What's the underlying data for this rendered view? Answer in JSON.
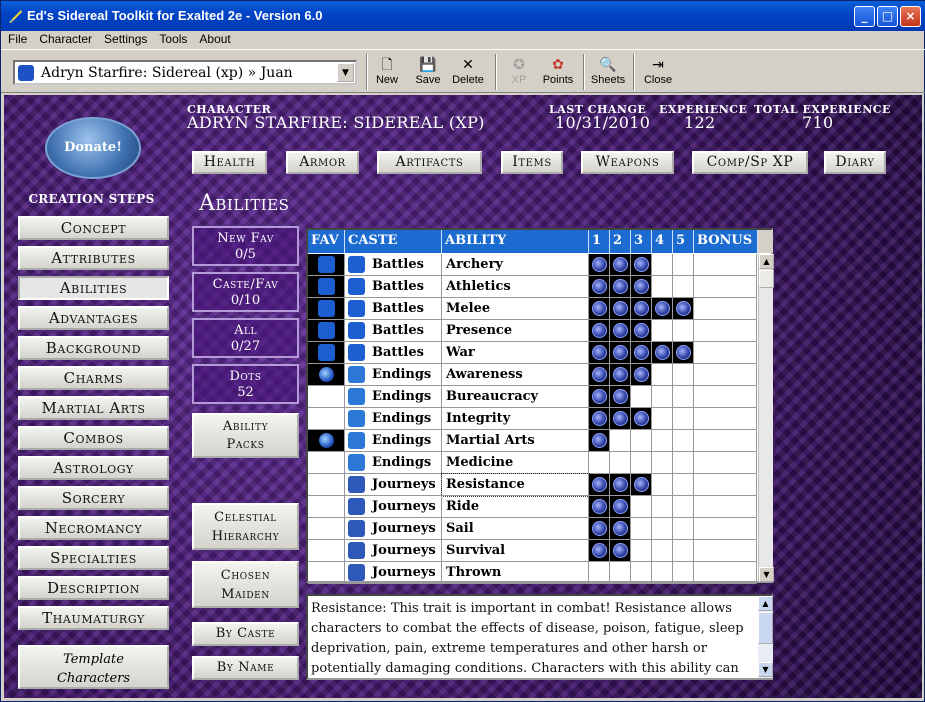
{
  "window": {
    "title": "Ed's Sidereal Toolkit for Exalted 2e - Version 6.0",
    "controls": {
      "minimize": "_",
      "maximize": "□",
      "close": "×"
    }
  },
  "menu": [
    "File",
    "Character",
    "Settings",
    "Tools",
    "About"
  ],
  "toolbar": {
    "selector": "Adryn Starfire: Sidereal (xp) » Juan",
    "buttons": [
      {
        "label": "New",
        "icon": "new-document-icon",
        "enabled": true
      },
      {
        "label": "Save",
        "icon": "floppy-disk-icon",
        "enabled": true
      },
      {
        "label": "Delete",
        "icon": "delete-x-icon",
        "enabled": true
      },
      {
        "label": "XP",
        "icon": "xp-icon",
        "enabled": false
      },
      {
        "label": "Points",
        "icon": "points-icon",
        "enabled": true
      },
      {
        "label": "Sheets",
        "icon": "sheet-magnifier-icon",
        "enabled": true
      },
      {
        "label": "Close",
        "icon": "exit-door-icon",
        "enabled": true
      }
    ]
  },
  "donate": "Donate!",
  "creation_steps": {
    "label": "Creation Steps",
    "items": [
      "Concept",
      "Attributes",
      "Abilities",
      "Advantages",
      "Background",
      "Charms",
      "Martial Arts",
      "Combos",
      "Astrology",
      "Sorcery",
      "Necromancy",
      "Specialties",
      "Description",
      "Thaumaturgy"
    ],
    "active": "Abilities",
    "template": "Template Characters"
  },
  "header": {
    "character_label": "Character",
    "character_value": "Adryn Starfire: Sidereal (xp)",
    "last_change_label": "Last Change",
    "last_change_value": "10/31/2010",
    "experience_label": "Experience",
    "experience_value": "122",
    "total_label": "Total Experience",
    "total_value": "710"
  },
  "nav": [
    "Health",
    "Armor",
    "Artifacts",
    "Items",
    "Weapons",
    "Comp/Sp XP",
    "Diary"
  ],
  "section_title": "Abilities",
  "counters": [
    {
      "label": "New Fav",
      "value": "0/5"
    },
    {
      "label": "Caste/Fav",
      "value": "0/10"
    },
    {
      "label": "All",
      "value": "0/27"
    },
    {
      "label": "Dots",
      "value": "52"
    }
  ],
  "side_buttons": {
    "ability_packs": "Ability Packs",
    "celestial": "Celestial Hierarchy",
    "chosen": "Chosen Maiden",
    "by_caste": "By Caste",
    "by_name": "By Name"
  },
  "grid": {
    "headers": [
      "FAV",
      "CASTE",
      "ABILITY",
      "1",
      "2",
      "3",
      "4",
      "5",
      "BONUS"
    ],
    "rows": [
      {
        "fav": "caste-sign-icon",
        "caste": "Battles",
        "ability": "Archery",
        "dots": 3
      },
      {
        "fav": "caste-sign-icon",
        "caste": "Battles",
        "ability": "Athletics",
        "dots": 3
      },
      {
        "fav": "caste-sign-icon",
        "caste": "Battles",
        "ability": "Melee",
        "dots": 5
      },
      {
        "fav": "caste-sign-icon",
        "caste": "Battles",
        "ability": "Presence",
        "dots": 3
      },
      {
        "fav": "caste-sign-icon",
        "caste": "Battles",
        "ability": "War",
        "dots": 5
      },
      {
        "fav": "favored-dot-icon",
        "caste": "Endings",
        "ability": "Awareness",
        "dots": 3
      },
      {
        "fav": "",
        "caste": "Endings",
        "ability": "Bureaucracy",
        "dots": 2
      },
      {
        "fav": "",
        "caste": "Endings",
        "ability": "Integrity",
        "dots": 3
      },
      {
        "fav": "favored-dot-icon",
        "caste": "Endings",
        "ability": "Martial Arts",
        "dots": 1
      },
      {
        "fav": "",
        "caste": "Endings",
        "ability": "Medicine",
        "dots": 0
      },
      {
        "fav": "",
        "caste": "Journeys",
        "ability": "Resistance",
        "dots": 3
      },
      {
        "fav": "",
        "caste": "Journeys",
        "ability": "Ride",
        "dots": 2
      },
      {
        "fav": "",
        "caste": "Journeys",
        "ability": "Sail",
        "dots": 2
      },
      {
        "fav": "",
        "caste": "Journeys",
        "ability": "Survival",
        "dots": 2
      },
      {
        "fav": "",
        "caste": "Journeys",
        "ability": "Thrown",
        "dots": 0
      }
    ]
  },
  "description": "Resistance:  This trait is important in combat!  Resistance allows characters to combat the effects of disease, poison, fatigue, sleep deprivation, pain, extreme temperatures and other harsh or potentially damaging conditions.  Characters with this ability can",
  "colors": {
    "accent": "#1c6bd0",
    "titlebar": "#0244c6",
    "background": "#3a1460",
    "dot": "#3447a8"
  }
}
